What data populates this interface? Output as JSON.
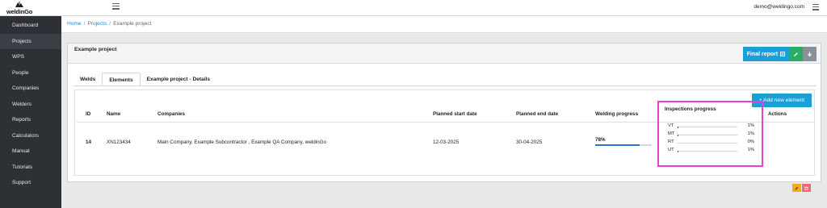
{
  "app": {
    "logo_text": "weldinGo"
  },
  "sidebar": {
    "items": [
      {
        "label": "Dashboard",
        "icon": "dashboard-icon"
      },
      {
        "label": "Projects",
        "icon": "projects-icon"
      },
      {
        "label": "WPS",
        "icon": "wps-icon"
      },
      {
        "label": "People",
        "icon": "people-icon"
      },
      {
        "label": "Companies",
        "icon": "companies-icon"
      },
      {
        "label": "Welders",
        "icon": "welders-icon"
      },
      {
        "label": "Reports",
        "icon": "reports-icon"
      },
      {
        "label": "Calculators",
        "icon": "calculators-icon"
      },
      {
        "label": "Manual",
        "icon": "manual-icon"
      },
      {
        "label": "Tutorials",
        "icon": "tutorials-icon"
      },
      {
        "label": "Support",
        "icon": "support-icon"
      }
    ],
    "active_index": 1
  },
  "topbar": {
    "user_email": "demo@weldingo.com"
  },
  "breadcrumb": {
    "items": [
      "Home",
      "Projects",
      "Example project"
    ],
    "separator": "/"
  },
  "card": {
    "title": "Example project",
    "final_report_label": "Final report",
    "colors": {
      "primary": "#1aa0d6",
      "success": "#27ae60",
      "secondary": "#8a9099",
      "highlight": "#e541d6"
    }
  },
  "tabs": [
    {
      "label": "Welds"
    },
    {
      "label": "Elements"
    },
    {
      "label": "Example project - Details"
    }
  ],
  "panel": {
    "add_button_label": "+ Add new element",
    "columns": [
      "ID",
      "Name",
      "Companies",
      "Planned start date",
      "Planned end date",
      "Welding progress",
      "Inspections progress",
      "Actions"
    ],
    "rows": [
      {
        "id": "14",
        "name": "XN123434",
        "companies": "Main Company, Example Subcontractor , Example QA Company, weldinGo",
        "start": "12-03-2025",
        "end": "30-04-2025",
        "welding_progress_label": "78%",
        "welding_progress_value": 78,
        "inspections": [
          {
            "type": "VT",
            "pct": "1%",
            "value": 1
          },
          {
            "type": "MT",
            "pct": "1%",
            "value": 1
          },
          {
            "type": "RT",
            "pct": "0%",
            "value": 0
          },
          {
            "type": "UT",
            "pct": "1%",
            "value": 1
          }
        ]
      }
    ]
  }
}
